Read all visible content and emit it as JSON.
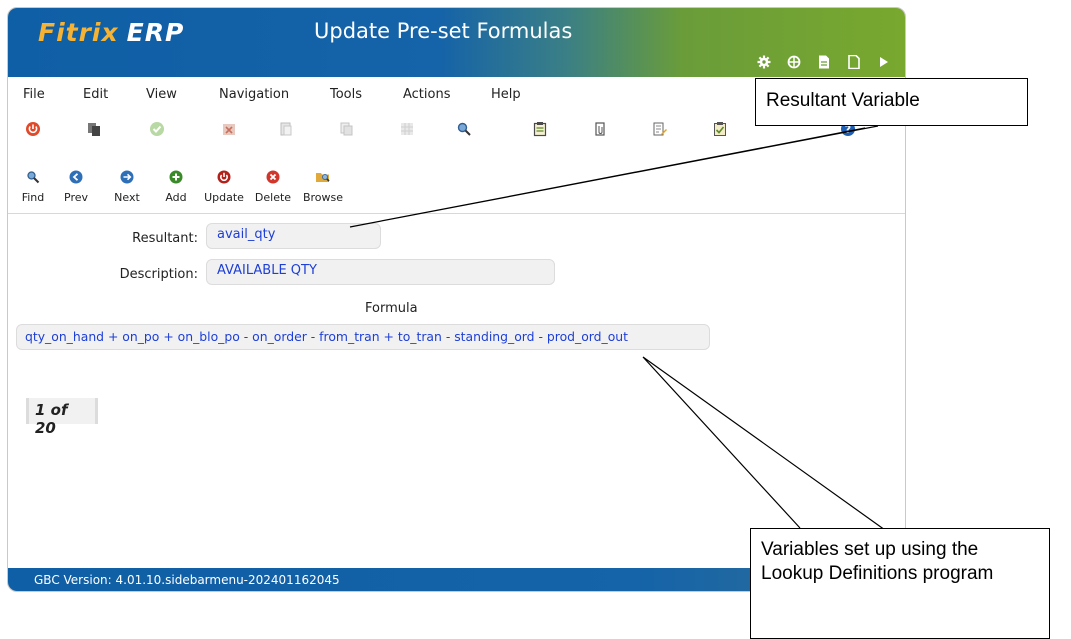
{
  "app": {
    "brand": "Fitrix",
    "erp": "ERP",
    "title": "Update Pre-set Formulas"
  },
  "header_icons": [
    "gear-icon",
    "globe-icon",
    "document-icon",
    "new-page-icon",
    "play-icon"
  ],
  "menu": [
    "File",
    "Edit",
    "View",
    "Navigation",
    "Tools",
    "Actions",
    "Help"
  ],
  "toolbar_icons": [
    "power-icon",
    "copy-icon",
    "check-icon",
    "cancel-icon",
    "paste-icon",
    "duplicate-icon",
    "grid-icon",
    "zoom-icon",
    "notes-icon",
    "attach-icon",
    "edit-doc-icon",
    "checklist-icon",
    "help-icon"
  ],
  "actions": [
    {
      "label": "Find",
      "icon": "find-icon"
    },
    {
      "label": "Prev",
      "icon": "prev-icon"
    },
    {
      "label": "Next",
      "icon": "next-icon"
    },
    {
      "label": "Add",
      "icon": "add-icon"
    },
    {
      "label": "Update",
      "icon": "update-icon"
    },
    {
      "label": "Delete",
      "icon": "delete-icon"
    },
    {
      "label": "Browse",
      "icon": "browse-icon"
    }
  ],
  "form": {
    "resultant_label": "Resultant:",
    "resultant_value": "avail_qty",
    "description_label": "Description:",
    "description_value": "AVAILABLE QTY",
    "formula_label": "Formula",
    "formula_value": "qty_on_hand + on_po + on_blo_po - on_order - from_tran + to_tran - standing_ord - prod_ord_out"
  },
  "record_count": "1 of 20",
  "footer": "GBC Version: 4.01.10.sidebarmenu-202401162045",
  "callouts": {
    "resultant": "Resultant Variable",
    "variables": "Variables set up using the Lookup Definitions program"
  },
  "colors": {
    "header_blue": "#1563a8",
    "header_green": "#79a82e",
    "brand_orange": "#f6b233",
    "field_text": "#1e3fd6"
  }
}
